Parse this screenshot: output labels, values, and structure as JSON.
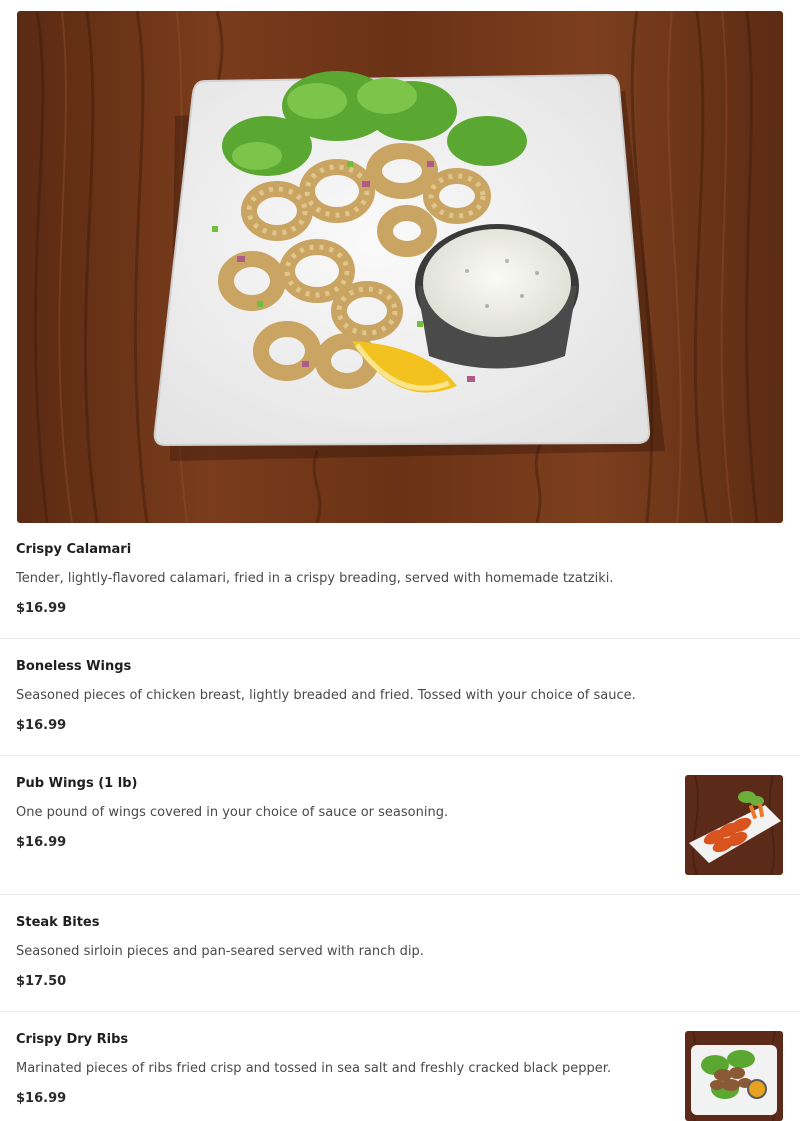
{
  "hero": {
    "image_alt": "Crispy Calamari plate with tzatziki and lemon",
    "icon": "food-photo"
  },
  "items": [
    {
      "name": "Crispy Calamari",
      "description": "Tender, lightly-flavored calamari, fried in a crispy breading, served with homemade tzatziki.",
      "price": "$16.99"
    },
    {
      "name": "Boneless Wings",
      "description": "Seasoned pieces of chicken breast, lightly breaded and fried. Tossed with your choice of sauce.",
      "price": "$16.99"
    },
    {
      "name": "Pub Wings (1 lb)",
      "description": "One pound of wings covered in your choice of sauce or seasoning.",
      "price": "$16.99"
    },
    {
      "name": "Steak Bites",
      "description": "Seasoned sirloin pieces and pan-seared served with ranch dip.",
      "price": "$17.50"
    },
    {
      "name": "Crispy Dry Ribs",
      "description": "Marinated pieces of ribs fried crisp and tossed in sea salt and freshly cracked black pepper.",
      "price": "$16.99"
    }
  ],
  "colors": {
    "text_primary": "#1f1f1f",
    "text_secondary": "#4a4a4a",
    "divider": "#ececec",
    "wood": "#6b3418"
  }
}
